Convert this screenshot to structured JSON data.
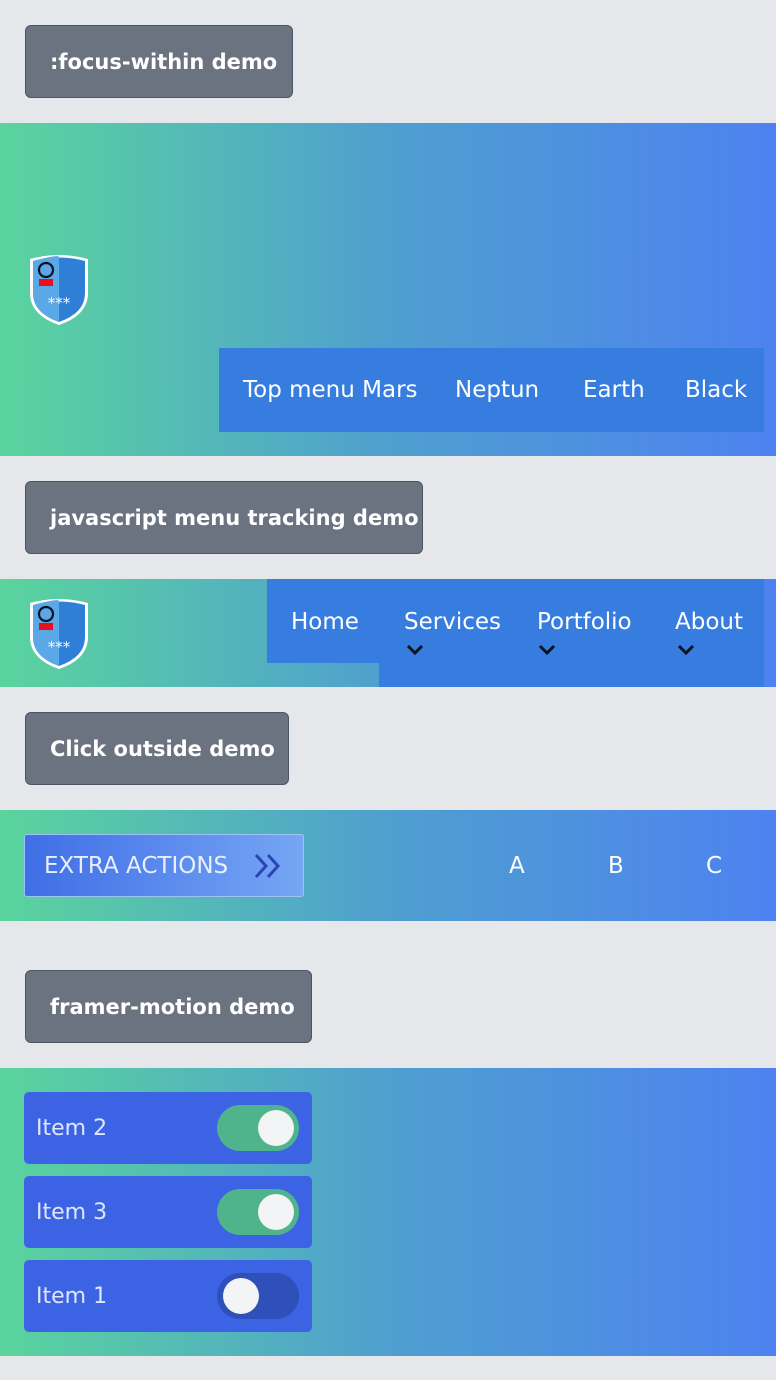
{
  "sections": {
    "focus_within": {
      "label": ":focus-within demo",
      "menu": [
        "Top menu Mars",
        "Neptun",
        "Earth",
        "Black"
      ]
    },
    "js_tracking": {
      "label": "javascript menu tracking demo",
      "menu": [
        {
          "label": "Home",
          "has_dropdown": false
        },
        {
          "label": "Services",
          "has_dropdown": true
        },
        {
          "label": "Portfolio",
          "has_dropdown": true
        },
        {
          "label": "About",
          "has_dropdown": true
        }
      ]
    },
    "click_outside": {
      "label": "Click outside demo",
      "extra_actions_label": "EXTRA ACTIONS",
      "letters": [
        "A",
        "B",
        "C"
      ]
    },
    "framer_motion": {
      "label": "framer-motion demo",
      "items": [
        {
          "label": "Item 2",
          "on": true
        },
        {
          "label": "Item 3",
          "on": true
        },
        {
          "label": "Item 1",
          "on": false
        }
      ]
    }
  },
  "logo": {
    "stars": "***"
  },
  "icons": {
    "logo": "shield-logo-icon",
    "chevron": "chevron-down-icon",
    "double_chevron": "double-chevron-right-icon"
  },
  "colors": {
    "page_bg": "#e5e7eb",
    "label_bg": "#6b7280",
    "gradient_start": "#5ad49d",
    "gradient_end": "#4d82f0",
    "menu_bg": "#367ddf",
    "toggle_row_bg": "#3d63e5",
    "switch_on": "#4fb48b",
    "switch_off": "#2f4fb9"
  }
}
